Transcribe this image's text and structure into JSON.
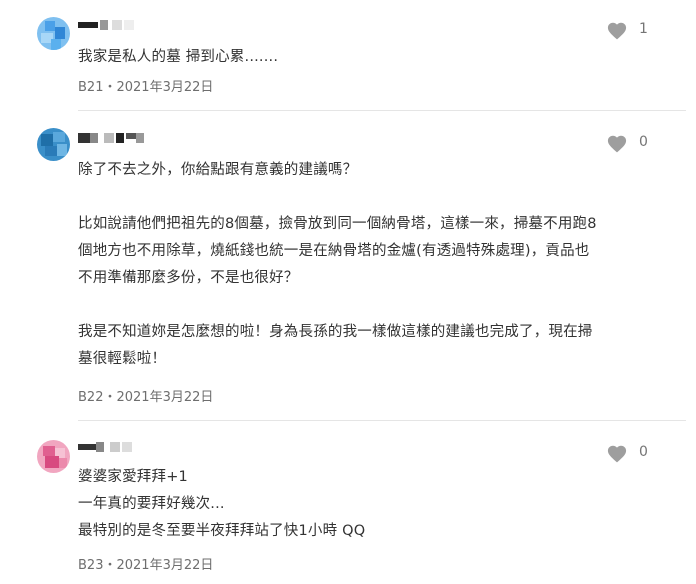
{
  "comments": [
    {
      "floor": "B21",
      "date": "2021年3月22日",
      "text": "我家是私人的墓 掃到心累.......",
      "likes": "1",
      "avatar_color": "#5aa6e6"
    },
    {
      "floor": "B22",
      "date": "2021年3月22日",
      "text": "除了不去之外，你給點跟有意義的建議嗎？\n\n比如說請他們把祖先的8個墓，撿骨放到同一個納骨塔，這樣一來，掃墓不用跑8\n個地方也不用除草，燒紙錢也統一是在納骨塔的金爐(有透過特殊處理)，貢品也\n不用準備那麼多份，不是也很好？\n\n我是不知道妳是怎麼想的啦！身為長孫的我一樣做這樣的建議也完成了，現在掃\n墓很輕鬆啦！",
      "likes": "0",
      "avatar_color": "#3a8fc9"
    },
    {
      "floor": "B23",
      "date": "2021年3月22日",
      "text": "婆婆家愛拜拜+1\n一年真的要拜好幾次...\n最特別的是冬至要半夜拜拜站了快1小時 QQ",
      "likes": "0",
      "avatar_color": "#e8749a"
    }
  ],
  "meta_separator": "・",
  "like_icon": "heart-icon"
}
